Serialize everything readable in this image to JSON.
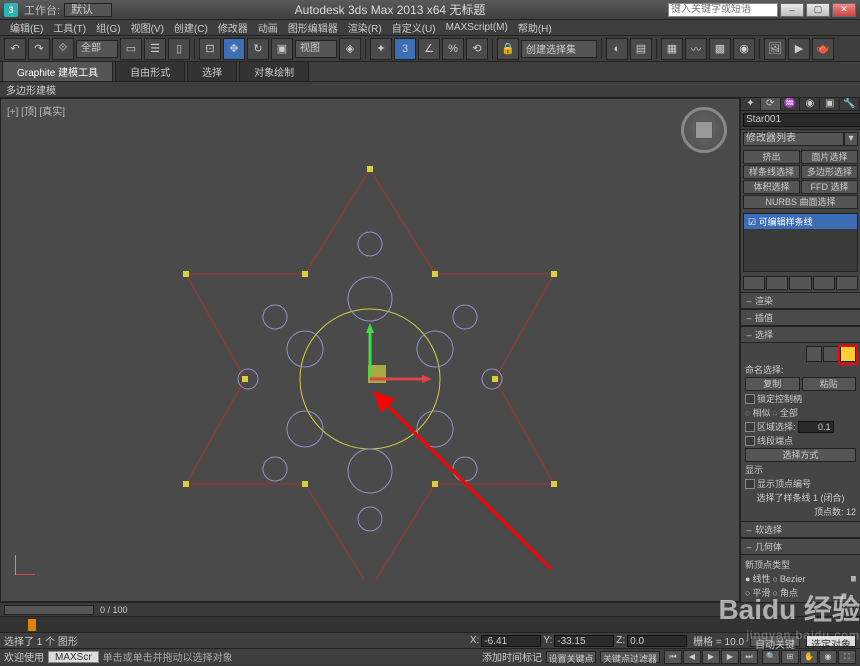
{
  "titlebar": {
    "workspace_label": "工作台:",
    "workspace_value": "默认",
    "app_title": "Autodesk 3ds Max  2013 x64   无标题",
    "search_placeholder": "键入关键字或短语"
  },
  "menubar": [
    "编辑(E)",
    "工具(T)",
    "组(G)",
    "视图(V)",
    "创建(C)",
    "修改器",
    "动画",
    "图形编辑器",
    "渲染(R)",
    "自定义(U)",
    "MAXScript(M)",
    "帮助(H)"
  ],
  "toolbar": {
    "filter_combo": "全部",
    "view_combo": "视图",
    "create_combo": "创建选择集"
  },
  "ribbon": {
    "tabs": [
      "Graphite 建模工具",
      "自由形式",
      "选择",
      "对象绘制"
    ],
    "subrow": "多边形建模"
  },
  "viewport": {
    "label": "[+] [顶] [真实]"
  },
  "right_panel": {
    "object_name": "Star001",
    "modifier_dropdown": "修改器列表",
    "stack_item": "☑ 可编辑样条线",
    "top_buttons": [
      "挤出",
      "面片选择",
      "样条线选择",
      "多边形选择",
      "体积选择",
      "FFD 选择"
    ],
    "nurbs_btn": "NURBS 曲面选择",
    "rollouts": {
      "render": "渲染",
      "interp": "插值",
      "sel": "选择",
      "named_sel": "命名选择:",
      "copy": "复制",
      "paste": "粘贴",
      "lock_handles": "锁定控制柄",
      "similar": "相似",
      "all": "全部",
      "area_sel": "区域选择:",
      "area_val": "0.1",
      "segment_end": "线段端点",
      "sel_method": "选择方式",
      "display": "显示",
      "show_vertex_num": "显示顶点编号",
      "selected_info": "选择了样条线 1 (闭合)",
      "vertex_count": "顶点数: 12",
      "soft_sel": "软选择",
      "geometry": "几何体",
      "new_vertex_type": "新顶点类型",
      "linear": "线性",
      "bezier": "Bezier",
      "smooth": "平滑",
      "corner": "角点"
    }
  },
  "timeline": {
    "frame_display": "0 / 100"
  },
  "statusbar": {
    "selection": "选择了 1 个 图形",
    "x_label": "X:",
    "x_val": "-6.41",
    "y_label": "Y:",
    "y_val": "-33.15",
    "z_label": "Z:",
    "z_val": "0.0",
    "grid": "栅格 = 10.0",
    "autokey": "自动关键点",
    "selected_obj": "选定对象"
  },
  "statusbar2": {
    "welcome": "欢迎使用",
    "maxs": "MAXScr",
    "prompt": "单击或单击并拖动以选择对象",
    "add_time": "添加时间标记",
    "setkey": "设置关键点",
    "keyfilter": "关键点过滤器"
  },
  "watermark": {
    "brand": "Baidu 经验",
    "url": "jingyan.baidu.com"
  }
}
